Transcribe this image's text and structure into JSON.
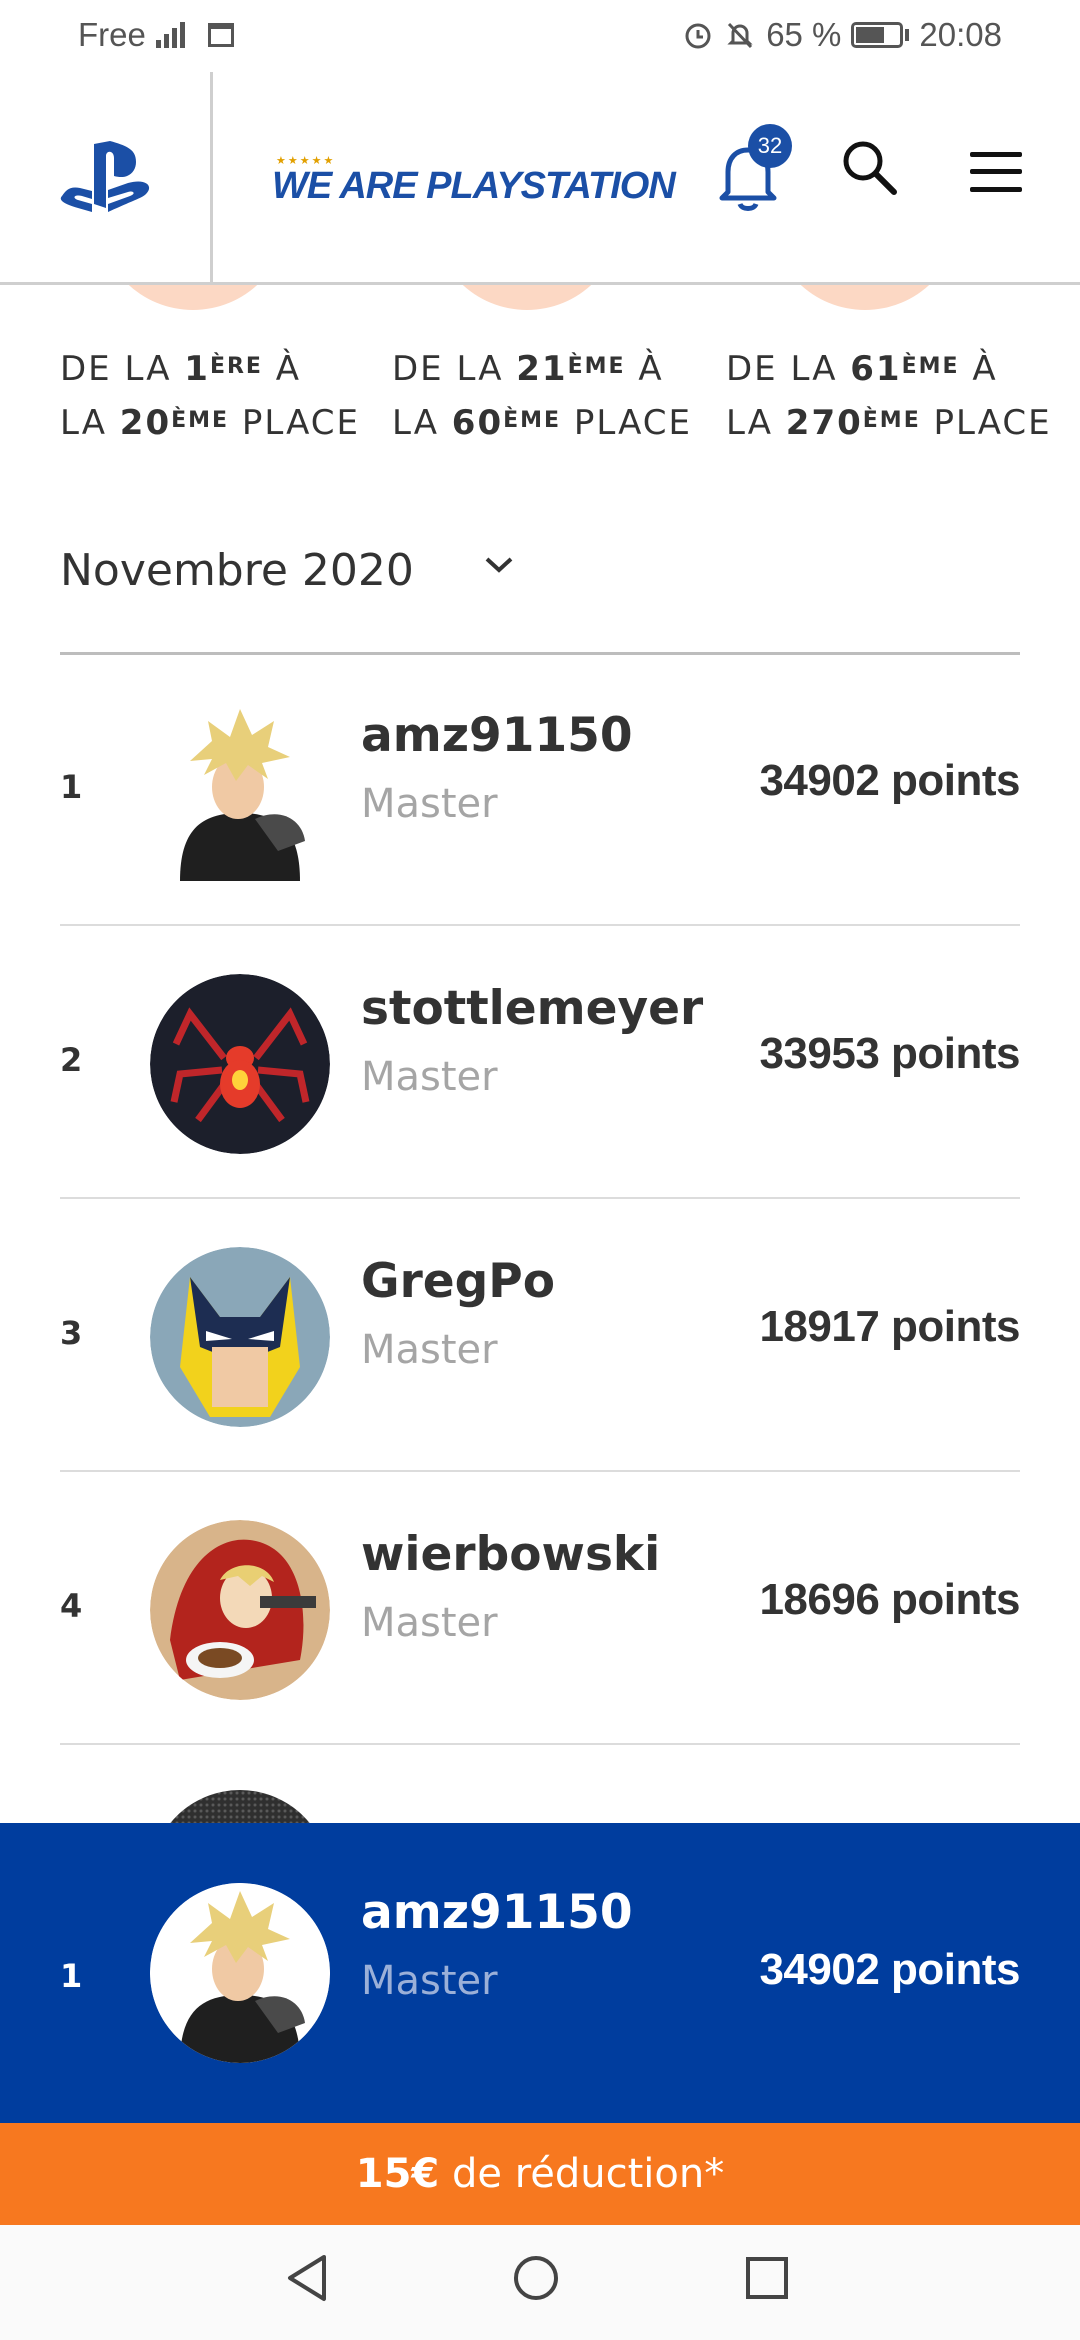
{
  "status_bar": {
    "carrier": "Free",
    "network": "4G",
    "battery": "65 %",
    "time": "20:08"
  },
  "header": {
    "brand": "WE ARE PLAYSTATION",
    "brand_stars": "★★★★★",
    "notification_count": "32",
    "icons": [
      "playstation-logo",
      "bell-icon",
      "search-icon",
      "menu-icon"
    ]
  },
  "tiers": [
    {
      "prefix": "DE LA ",
      "from_num": "1",
      "from_sup": "ÈRE",
      "mid": " À",
      "line2_prefix": "LA ",
      "to_num": "20",
      "to_sup": "ÈME",
      "suffix": " PLACE"
    },
    {
      "prefix": "DE LA ",
      "from_num": "21",
      "from_sup": "ÈME",
      "mid": " À",
      "line2_prefix": "LA ",
      "to_num": "60",
      "to_sup": "ÈME",
      "suffix": " PLACE"
    },
    {
      "prefix": "DE LA ",
      "from_num": "61",
      "from_sup": "ÈME",
      "mid": " À",
      "line2_prefix": "LA ",
      "to_num": "270",
      "to_sup": "ÈME",
      "suffix": " PLACE"
    }
  ],
  "month_selector": {
    "selected": "Novembre 2020"
  },
  "leaderboard": [
    {
      "rank": "1",
      "username": "amz91150",
      "level": "Master",
      "points": "34902 points",
      "avatar": "cloud-strife-avatar"
    },
    {
      "rank": "2",
      "username": "stottlemeyer",
      "level": "Master",
      "points": "33953 points",
      "avatar": "spider-emblem-avatar"
    },
    {
      "rank": "3",
      "username": "GregPo",
      "level": "Master",
      "points": "18917 points",
      "avatar": "wolverine-mask-avatar"
    },
    {
      "rank": "4",
      "username": "wierbowski",
      "level": "Master",
      "points": "18696 points",
      "avatar": "red-hood-avatar"
    }
  ],
  "current_user": {
    "rank": "1",
    "username": "amz91150",
    "level": "Master",
    "points": "34902 points"
  },
  "promo": {
    "amount": "15€",
    "text": " de réduction*"
  },
  "colors": {
    "brand_blue": "#003d9e",
    "promo_orange": "#f7781f",
    "tier_peach": "#fcd8c4",
    "level_grey": "#a5a5a5"
  }
}
